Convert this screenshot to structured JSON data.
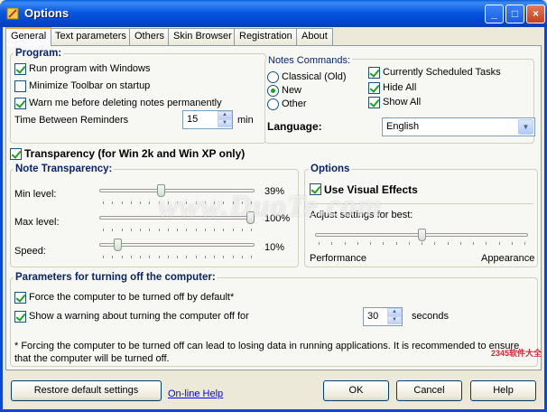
{
  "window": {
    "title": "Options",
    "min": "_",
    "max": "□",
    "close": "×"
  },
  "tabs": [
    "General",
    "Text parameters",
    "Others",
    "Skin Browser",
    "Registration",
    "About"
  ],
  "program": {
    "title": "Program:",
    "run_windows": "Run program with Windows",
    "minimize_toolbar": "Minimize Toolbar on startup",
    "warn_delete": "Warn me before deleting notes permanently",
    "reminders_label": "Time Between Reminders",
    "reminders_value": "15",
    "reminders_unit": "min"
  },
  "notes_commands": {
    "title": "Notes Commands:",
    "classical": "Classical (Old)",
    "new": "New",
    "other": "Other",
    "scheduled": "Currently Scheduled Tasks",
    "hide_all": "Hide All",
    "show_all": "Show All"
  },
  "language": {
    "label": "Language:",
    "value": "English"
  },
  "transparency": {
    "label": "Transparency (for Win 2k and Win XP only)",
    "group_title": "Note Transparency:",
    "min_label": "Min level:",
    "min_value": "39%",
    "min_pos": 0.39,
    "max_label": "Max level:",
    "max_value": "100%",
    "max_pos": 1.0,
    "speed_label": "Speed:",
    "speed_value": "10%",
    "speed_pos": 0.1
  },
  "options": {
    "title": "Options",
    "visual_effects": "Use Visual Effects",
    "adjust": "Adjust settings for best:",
    "performance": "Performance",
    "appearance": "Appearance",
    "slider_pos": 0.5
  },
  "shutdown": {
    "title": "Parameters for turning off the computer:",
    "force": "Force the computer to be turned off by default*",
    "warning": "Show a warning about turning the computer off for",
    "seconds_value": "30",
    "seconds_label": "seconds",
    "note": "* Forcing the computer to be turned off can lead to losing data in running applications. It is recommended to ensure that the computer will be turned off."
  },
  "footer": {
    "restore": "Restore default settings",
    "help_link": "On-line Help",
    "ok": "OK",
    "cancel": "Cancel",
    "help": "Help"
  },
  "watermark": {
    "text": "www.DuoTe.com",
    "site": "2345软件大全"
  }
}
